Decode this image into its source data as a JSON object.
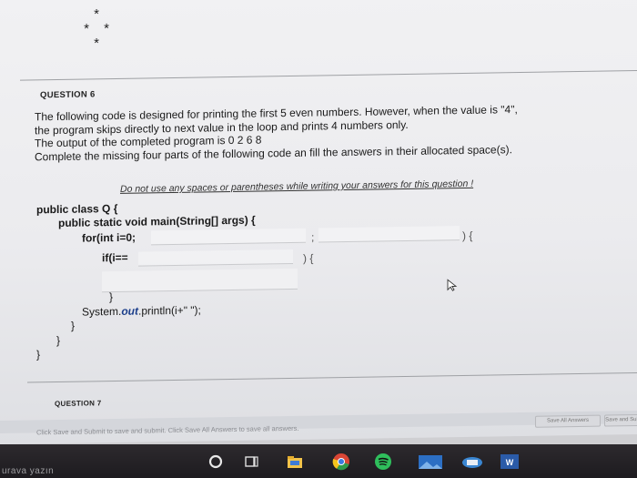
{
  "previous_question": {
    "stars": [
      "* * *",
      "* *",
      "*"
    ]
  },
  "question6": {
    "label": "QUESTION 6",
    "lines": [
      "The following code is designed for printing the first 5 even numbers. However, when the value is \"4\",",
      "the program skips directly to next value in the loop and prints 4 numbers only.",
      "The output of the completed program is 0 2 6 8",
      "Complete the missing four parts of the following code an fill the answers in their allocated space(s)."
    ],
    "note": "Do not use any spaces or parentheses while writing your answers for this question !",
    "code": {
      "line1": "public class Q {",
      "line2": "public static void main(String[] args) {",
      "line3": "for(int i=0;",
      "line3_semicolon": ";",
      "line3_close": ") {",
      "line4": "if(i==",
      "line4_close": ") {",
      "line5": "}",
      "line6_pre": "System.",
      "line6_out": "out",
      "line6_post": ".println(i+\" \");",
      "line7": "}",
      "line8": "}",
      "line9": "}"
    }
  },
  "question7": {
    "label": "QUESTION 7"
  },
  "footer": {
    "text": "Click Save and Submit to save and submit. Click Save All Answers to save all answers.",
    "save_all_label": "Save All Answers",
    "save_submit_label": "Save and Submit"
  },
  "taskbar": {
    "search_text": "urava yazın",
    "icons": [
      "search-circle-icon",
      "task-view-icon",
      "file-explorer-icon",
      "chrome-icon",
      "spotify-icon",
      "photos-icon",
      "mail-icon",
      "word-icon"
    ]
  },
  "colors": {
    "taskbar": "#1f1d21",
    "page": "#ececef",
    "keyword_out": "#1a3d8a"
  }
}
